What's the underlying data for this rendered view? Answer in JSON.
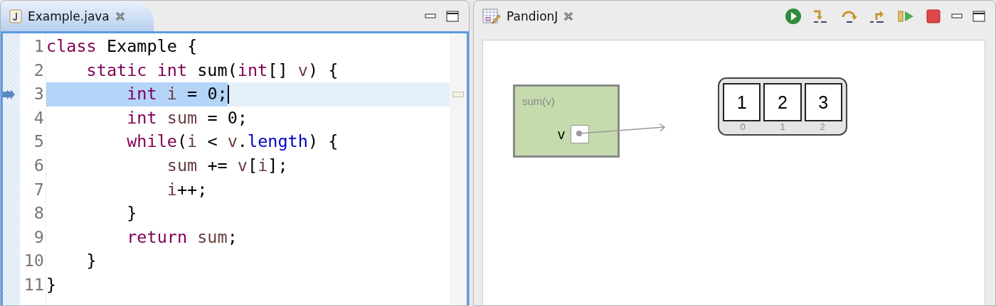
{
  "editor": {
    "tab": {
      "label": "Example.java",
      "selected": true
    },
    "lines": [
      {
        "number": "1",
        "current": false,
        "tokens": [
          {
            "kind": "keyword",
            "text": "class"
          },
          {
            "kind": "plain",
            "text": " Example {"
          }
        ]
      },
      {
        "number": "2",
        "current": false,
        "tokens": [
          {
            "kind": "keyword",
            "text": "    static int"
          },
          {
            "kind": "plain",
            "text": " sum("
          },
          {
            "kind": "keyword",
            "text": "int"
          },
          {
            "kind": "plain",
            "text": "[] "
          },
          {
            "kind": "variable",
            "text": "v"
          },
          {
            "kind": "plain",
            "text": ") {"
          }
        ]
      },
      {
        "number": "3",
        "current": true,
        "tokens": [
          {
            "kind": "keyword",
            "text": "        int"
          },
          {
            "kind": "variable",
            "text": " i"
          },
          {
            "kind": "plain",
            "text": " = 0;"
          }
        ]
      },
      {
        "number": "4",
        "current": false,
        "tokens": [
          {
            "kind": "keyword",
            "text": "        int"
          },
          {
            "kind": "variable",
            "text": " sum"
          },
          {
            "kind": "plain",
            "text": " = 0;"
          }
        ]
      },
      {
        "number": "5",
        "current": false,
        "tokens": [
          {
            "kind": "keyword",
            "text": "        while"
          },
          {
            "kind": "plain",
            "text": "("
          },
          {
            "kind": "variable",
            "text": "i"
          },
          {
            "kind": "plain",
            "text": " < "
          },
          {
            "kind": "variable",
            "text": "v"
          },
          {
            "kind": "plain",
            "text": "."
          },
          {
            "kind": "field",
            "text": "length"
          },
          {
            "kind": "plain",
            "text": ") {"
          }
        ]
      },
      {
        "number": "6",
        "current": false,
        "tokens": [
          {
            "kind": "variable",
            "text": "            sum"
          },
          {
            "kind": "plain",
            "text": " += "
          },
          {
            "kind": "variable",
            "text": "v"
          },
          {
            "kind": "plain",
            "text": "["
          },
          {
            "kind": "variable",
            "text": "i"
          },
          {
            "kind": "plain",
            "text": "];"
          }
        ]
      },
      {
        "number": "7",
        "current": false,
        "tokens": [
          {
            "kind": "variable",
            "text": "            i"
          },
          {
            "kind": "plain",
            "text": "++;"
          }
        ]
      },
      {
        "number": "8",
        "current": false,
        "tokens": [
          {
            "kind": "plain",
            "text": "        }"
          }
        ]
      },
      {
        "number": "9",
        "current": false,
        "tokens": [
          {
            "kind": "keyword",
            "text": "        return"
          },
          {
            "kind": "variable",
            "text": " sum"
          },
          {
            "kind": "plain",
            "text": ";"
          }
        ]
      },
      {
        "number": "10",
        "current": false,
        "tokens": [
          {
            "kind": "plain",
            "text": "    }"
          }
        ]
      },
      {
        "number": "11",
        "current": false,
        "tokens": [
          {
            "kind": "plain",
            "text": "}"
          }
        ]
      }
    ]
  },
  "viewer": {
    "tab": {
      "label": "PandionJ",
      "selected": false
    },
    "toolbar": [
      {
        "kind": "resume"
      },
      {
        "kind": "step-into"
      },
      {
        "kind": "step-over"
      },
      {
        "kind": "step-return"
      },
      {
        "kind": "run-to"
      },
      {
        "kind": "terminate"
      }
    ],
    "frames": [
      {
        "title": "sum(v)",
        "vars": [
          {
            "name": "v"
          }
        ]
      }
    ],
    "arrays": [
      {
        "values": [
          "1",
          "2",
          "3"
        ],
        "indices": [
          "0",
          "1",
          "2"
        ]
      }
    ]
  }
}
